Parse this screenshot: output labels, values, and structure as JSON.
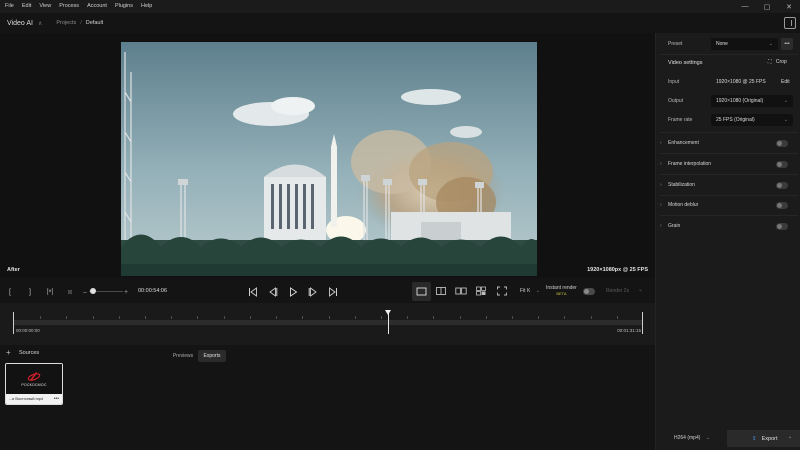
{
  "menu": [
    "File",
    "Edit",
    "View",
    "Process",
    "Account",
    "Plugins",
    "Help"
  ],
  "window_controls": {
    "minimize": "—",
    "maximize": "▢",
    "close": "✕"
  },
  "app": {
    "title": "Video AI"
  },
  "breadcrumb": {
    "projects": "Projects",
    "separator": "/",
    "current": "Default"
  },
  "viewer": {
    "after_label": "After",
    "resolution_label": "1920×1080px @ 25 FPS"
  },
  "toolbar": {
    "mark_in": "[",
    "mark_out": "]",
    "timecode": "00:00:54:06",
    "zoom_level": 0.12,
    "fit_label": "Fit",
    "fit_suffix": "K",
    "instant_render_label": "Instant render",
    "instant_render_badge": "BETA",
    "render_label": "Render 2s"
  },
  "timeline": {
    "start_time": "00:00:00:00",
    "end_time": "00:01:31:15",
    "playhead_fraction": 0.594
  },
  "sources": {
    "title": "Sources",
    "tabs": [
      "Previews",
      "Exports"
    ],
    "active_tab": "Exports",
    "items": [
      {
        "logo_text": "РОСКОСМОС",
        "name": "...и Восточный.mp4"
      }
    ]
  },
  "panel": {
    "preset": {
      "label": "Preset",
      "value": "None"
    },
    "video_settings": {
      "title": "Video settings",
      "crop_label": "Crop",
      "input": {
        "label": "Input",
        "value": "1920×1080 @ 25 FPS",
        "edit_label": "Edit"
      },
      "output": {
        "label": "Output",
        "value": "1920×1080 (Original)"
      },
      "frame_rate": {
        "label": "Frame rate",
        "value": "25 FPS (Original)"
      }
    },
    "sections": [
      {
        "label": "Enhancement",
        "enabled": false
      },
      {
        "label": "Frame interpolation",
        "enabled": false
      },
      {
        "label": "Stabilization",
        "enabled": false
      },
      {
        "label": "Motion deblur",
        "enabled": false
      },
      {
        "label": "Grain",
        "enabled": false
      }
    ],
    "export_format": "H264 (mp4)",
    "export_label": "Export"
  },
  "colors": {
    "background": "#141414",
    "panel": "#1b1b1b",
    "beta": "#c7c13a",
    "accent_logo": "#d3202a"
  },
  "icons": [
    "chevron-down-icon",
    "sidebar-toggle-icon",
    "crop-icon",
    "skip-back-icon",
    "step-back-icon",
    "play-icon",
    "step-forward-icon",
    "skip-forward-icon",
    "export-icon",
    "plus-icon",
    "more-icon"
  ]
}
